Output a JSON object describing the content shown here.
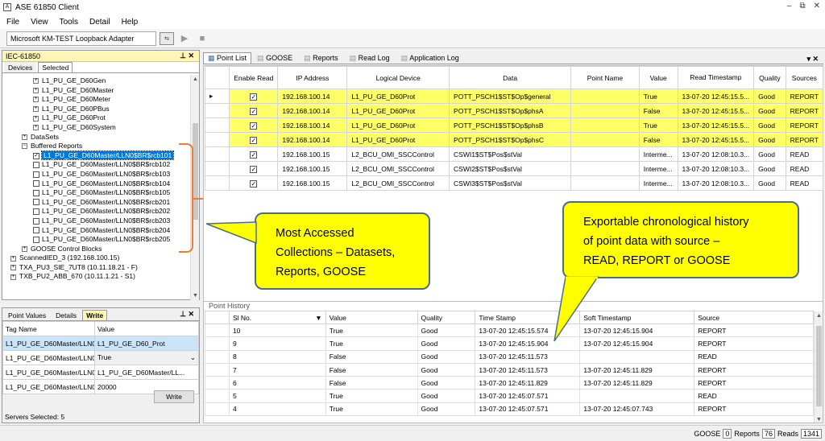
{
  "window": {
    "title": "ASE 61850 Client",
    "min": "–",
    "restore": "⧉",
    "close": "✕"
  },
  "menu": [
    "File",
    "View",
    "Tools",
    "Detail",
    "Help"
  ],
  "toolbar": {
    "adapter": "Microsoft KM-TEST Loopback Adapter"
  },
  "left_panel": {
    "title": "IEC-61850",
    "tabs": [
      "Devices",
      "Selected"
    ],
    "active_tab": "Selected",
    "tree": [
      {
        "level": 1,
        "exp": "+",
        "label": "L1_PU_GE_D60Gen"
      },
      {
        "level": 1,
        "exp": "+",
        "label": "L1_PU_GE_D60Master"
      },
      {
        "level": 1,
        "exp": "+",
        "label": "L1_PU_GE_D60Meter"
      },
      {
        "level": 1,
        "exp": "+",
        "label": "L1_PU_GE_D60PBus"
      },
      {
        "level": 1,
        "exp": "+",
        "label": "L1_PU_GE_D60Prot"
      },
      {
        "level": 1,
        "exp": "+",
        "label": "L1_PU_GE_D60System"
      },
      {
        "level": 0,
        "exp": "+",
        "label": "DataSets"
      },
      {
        "level": 0,
        "exp": "−",
        "label": "Buffered Reports"
      },
      {
        "level": 1,
        "chk": true,
        "selected": true,
        "label": "L1_PU_GE_D60Master/LLN0$BR$rcb101"
      },
      {
        "level": 1,
        "chk": false,
        "label": "L1_PU_GE_D60Master/LLN0$BR$rcb102"
      },
      {
        "level": 1,
        "chk": false,
        "label": "L1_PU_GE_D60Master/LLN0$BR$rcb103"
      },
      {
        "level": 1,
        "chk": false,
        "label": "L1_PU_GE_D60Master/LLN0$BR$rcb104"
      },
      {
        "level": 1,
        "chk": false,
        "label": "L1_PU_GE_D60Master/LLN0$BR$rcb105"
      },
      {
        "level": 1,
        "chk": false,
        "label": "L1_PU_GE_D60Master/LLN0$BR$rcb201"
      },
      {
        "level": 1,
        "chk": false,
        "label": "L1_PU_GE_D60Master/LLN0$BR$rcb202"
      },
      {
        "level": 1,
        "chk": false,
        "label": "L1_PU_GE_D60Master/LLN0$BR$rcb203"
      },
      {
        "level": 1,
        "chk": false,
        "label": "L1_PU_GE_D60Master/LLN0$BR$rcb204"
      },
      {
        "level": 1,
        "chk": false,
        "label": "L1_PU_GE_D60Master/LLN0$BR$rcb205"
      },
      {
        "level": 0,
        "exp": "+",
        "label": "GOOSE Control Blocks"
      },
      {
        "level": -1,
        "exp": "+",
        "label": "ScannedIED_3 (192.168.100.15)"
      },
      {
        "level": -1,
        "exp": "+",
        "label": "TXA_PU3_SIE_7UT8 (10.11.18.21 - F)"
      },
      {
        "level": -1,
        "exp": "+",
        "label": "TXB_PU2_ABB_670 (10.11.1.21 - S1)"
      }
    ]
  },
  "values_panel": {
    "tabs": [
      "Point Values",
      "Details",
      "Write"
    ],
    "active_tab": "Write",
    "headers": [
      "Tag Name",
      "Value"
    ],
    "rows": [
      {
        "tag": "L1_PU_GE_D60Master/LLN0",
        "value": "L1_PU_GE_D60_Prot"
      },
      {
        "tag": "L1_PU_GE_D60Master/LLN0",
        "value": "True"
      },
      {
        "tag": "L1_PU_GE_D60Master/LLN0",
        "value": "L1_PU_GE_D60Master/LL..."
      },
      {
        "tag": "L1_PU_GE_D60Master/LLN0",
        "value": "20000"
      }
    ],
    "write_button": "Write",
    "servers_selected": "Servers Selected: 5"
  },
  "doc_tabs": [
    "Point List",
    "GOOSE",
    "Reports",
    "Read Log",
    "Application Log"
  ],
  "active_doc_tab": "Point List",
  "point_list": {
    "headers": [
      "Enable Read",
      "IP Address",
      "Logical Device",
      "Data",
      "Point Name",
      "Value",
      "Read Timestamp",
      "Quality",
      "Sources"
    ],
    "rows": [
      {
        "ip": "192.168.100.14",
        "ld": "L1_PU_GE_D60Prot",
        "data": "POTT_PSCH1$ST$Op$general",
        "pn": "",
        "value": "True",
        "ts": "13-07-20 12:45:15.5...",
        "q": "Good",
        "src": "REPORT",
        "hl": true
      },
      {
        "ip": "192.168.100.14",
        "ld": "L1_PU_GE_D60Prot",
        "data": "POTT_PSCH1$ST$Op$phsA",
        "pn": "",
        "value": "False",
        "ts": "13-07-20 12:45:15.5...",
        "q": "Good",
        "src": "REPORT",
        "hl": true
      },
      {
        "ip": "192.168.100.14",
        "ld": "L1_PU_GE_D60Prot",
        "data": "POTT_PSCH1$ST$Op$phsB",
        "pn": "",
        "value": "True",
        "ts": "13-07-20 12:45:15.5...",
        "q": "Good",
        "src": "REPORT",
        "hl": true
      },
      {
        "ip": "192.168.100.14",
        "ld": "L1_PU_GE_D60Prot",
        "data": "POTT_PSCH1$ST$Op$phsC",
        "pn": "",
        "value": "False",
        "ts": "13-07-20 12:45:15.5...",
        "q": "Good",
        "src": "REPORT",
        "hl": true
      },
      {
        "ip": "192.168.100.15",
        "ld": "L2_BCU_OMI_SSCControl",
        "data": "CSWI1$ST$Pos$stVal",
        "pn": "",
        "value": "Interme...",
        "ts": "13-07-20 12:08:10.3...",
        "q": "Good",
        "src": "READ",
        "hl": false
      },
      {
        "ip": "192.168.100.15",
        "ld": "L2_BCU_OMI_SSCControl",
        "data": "CSWI2$ST$Pos$stVal",
        "pn": "",
        "value": "Interme...",
        "ts": "13-07-20 12:08:10.3...",
        "q": "Good",
        "src": "READ",
        "hl": false
      },
      {
        "ip": "192.168.100.15",
        "ld": "L2_BCU_OMI_SSCControl",
        "data": "CSWI3$ST$Pos$stVal",
        "pn": "",
        "value": "Interme...",
        "ts": "13-07-20 12:08:10.3...",
        "q": "Good",
        "src": "READ",
        "hl": false
      }
    ]
  },
  "point_history": {
    "title": "Point History",
    "headers": [
      "Sl No.",
      "Value",
      "Quality",
      "Time Stamp",
      "Soft Timestamp",
      "Source"
    ],
    "rows": [
      {
        "no": "10",
        "value": "True",
        "q": "Good",
        "ts": "13-07-20 12:45:15.574",
        "soft": "13-07-20 12:45:15.904",
        "src": "REPORT"
      },
      {
        "no": "9",
        "value": "True",
        "q": "Good",
        "ts": "13-07-20 12:45:15.904",
        "soft": "13-07-20 12:45:15.904",
        "src": "REPORT"
      },
      {
        "no": "8",
        "value": "False",
        "q": "Good",
        "ts": "13-07-20 12:45:11.573",
        "soft": "",
        "src": "READ"
      },
      {
        "no": "7",
        "value": "False",
        "q": "Good",
        "ts": "13-07-20 12:45:11.573",
        "soft": "13-07-20 12:45:11.829",
        "src": "REPORT"
      },
      {
        "no": "6",
        "value": "False",
        "q": "Good",
        "ts": "13-07-20 12:45:11.829",
        "soft": "13-07-20 12:45:11.829",
        "src": "REPORT"
      },
      {
        "no": "5",
        "value": "True",
        "q": "Good",
        "ts": "13-07-20 12:45:07.571",
        "soft": "",
        "src": "READ"
      },
      {
        "no": "4",
        "value": "True",
        "q": "Good",
        "ts": "13-07-20 12:45:07.571",
        "soft": "13-07-20 12:45:07.743",
        "src": "REPORT"
      }
    ]
  },
  "callouts": {
    "left": [
      "Most Accessed",
      "Collections – Datasets,",
      "Reports, GOOSE"
    ],
    "right": [
      "Exportable chronological history",
      "of point data with source –",
      "READ, REPORT or GOOSE"
    ]
  },
  "status": {
    "goose_label": "GOOSE",
    "goose": "0",
    "reports_label": "Reports",
    "reports": "76",
    "reads_label": "Reads",
    "reads": "1341"
  },
  "colors": {
    "highlight": "#ffff66",
    "callout": "#ffff00",
    "accent": "#0078d7",
    "bracket": "#ed7d31"
  }
}
